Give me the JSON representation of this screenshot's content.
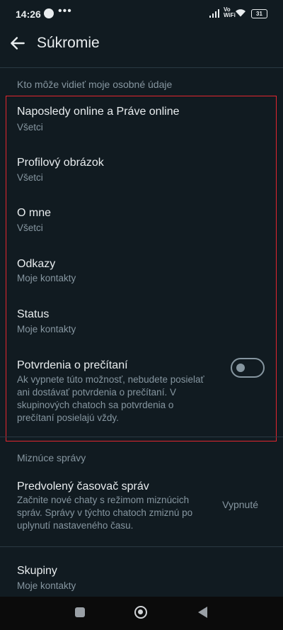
{
  "status_bar": {
    "time": "14:26",
    "messenger_icon": "messenger-icon",
    "more": "•••",
    "vo_wifi_top": "Vo",
    "vo_wifi_bottom": "WiFi",
    "battery": "31"
  },
  "header": {
    "title": "Súkromie",
    "back_icon": "arrow-left-icon"
  },
  "section_personal": {
    "heading": "Kto môže vidieť moje osobné údaje",
    "items": [
      {
        "title": "Naposledy online a Práve online",
        "value": "Všetci"
      },
      {
        "title": "Profilový obrázok",
        "value": "Všetci"
      },
      {
        "title": "O mne",
        "value": "Všetci"
      },
      {
        "title": "Odkazy",
        "value": "Moje kontakty"
      },
      {
        "title": "Status",
        "value": "Moje kontakty"
      }
    ],
    "read_receipts": {
      "title": "Potvrdenia o prečítaní",
      "description": "Ak vypnete túto možnosť, nebudete posielať ani dostávať potvrdenia o prečítaní. V skupinových chatoch sa potvrdenia o prečítaní posielajú vždy.",
      "enabled": false
    }
  },
  "section_disappearing": {
    "heading": "Miznúce správy",
    "default_timer": {
      "title": "Predvolený časovač správ",
      "description": "Začnite nové chaty s režimom miznúcich správ. Správy v týchto chatoch zmiznú po uplynutí nastaveného času.",
      "value": "Vypnuté"
    }
  },
  "groups": {
    "title": "Skupiny",
    "value": "Moje kontakty"
  },
  "colors": {
    "background": "#111b21",
    "highlight_border": "#e3262f",
    "secondary_text": "#8696a0"
  },
  "nav_bar": {
    "icons": [
      "recent-apps-icon",
      "home-icon",
      "back-icon"
    ]
  }
}
